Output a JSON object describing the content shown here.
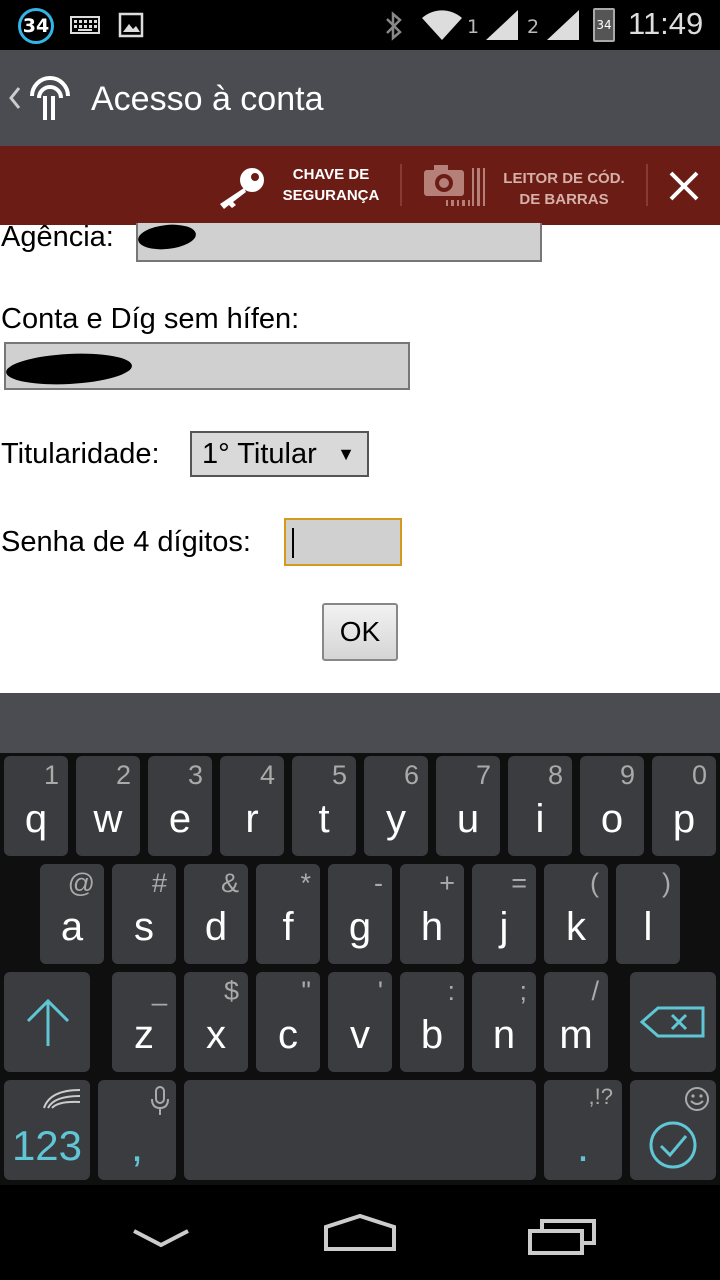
{
  "status_bar": {
    "notification_count": "34",
    "sim1": "1",
    "sim2": "2",
    "battery_level": "34",
    "time": "11:49"
  },
  "action_bar": {
    "title": "Acesso à conta"
  },
  "toolbar": {
    "security_key_label_line1": "CHAVE DE",
    "security_key_label_line2": "SEGURANÇA",
    "barcode_label_line1": "LEITOR DE CÓD.",
    "barcode_label_line2": "DE BARRAS"
  },
  "form": {
    "agency_label": "Agência:",
    "account_label": "Conta e Díg sem hífen:",
    "ownership_label": "Titularidade:",
    "ownership_selected": "1° Titular",
    "password_label": "Senha de 4 dígitos:",
    "ok_label": "OK"
  },
  "keyboard": {
    "row1": [
      {
        "main": "q",
        "hint": "1"
      },
      {
        "main": "w",
        "hint": "2"
      },
      {
        "main": "e",
        "hint": "3"
      },
      {
        "main": "r",
        "hint": "4"
      },
      {
        "main": "t",
        "hint": "5"
      },
      {
        "main": "y",
        "hint": "6"
      },
      {
        "main": "u",
        "hint": "7"
      },
      {
        "main": "i",
        "hint": "8"
      },
      {
        "main": "o",
        "hint": "9"
      },
      {
        "main": "p",
        "hint": "0"
      }
    ],
    "row2": [
      {
        "main": "a",
        "hint": "@"
      },
      {
        "main": "s",
        "hint": "#"
      },
      {
        "main": "d",
        "hint": "&"
      },
      {
        "main": "f",
        "hint": "*"
      },
      {
        "main": "g",
        "hint": "-"
      },
      {
        "main": "h",
        "hint": "+"
      },
      {
        "main": "j",
        "hint": "="
      },
      {
        "main": "k",
        "hint": "("
      },
      {
        "main": "l",
        "hint": ")"
      }
    ],
    "row3": [
      {
        "main": "z",
        "hint": "_"
      },
      {
        "main": "x",
        "hint": "$"
      },
      {
        "main": "c",
        "hint": "\""
      },
      {
        "main": "v",
        "hint": "'"
      },
      {
        "main": "b",
        "hint": ":"
      },
      {
        "main": "n",
        "hint": ";"
      },
      {
        "main": "m",
        "hint": "/"
      }
    ],
    "numbers_key": "123",
    "comma_key": ",",
    "period_key": ".",
    "period_hint": ",!?",
    "accent_color": "#5fc6d6"
  }
}
